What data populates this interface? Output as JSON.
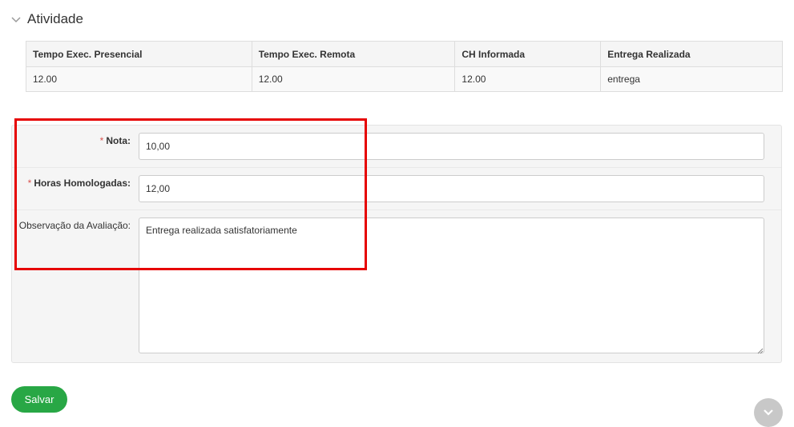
{
  "section": {
    "title": "Atividade",
    "icon": "chevron-down-icon"
  },
  "table": {
    "headers": [
      "Tempo Exec. Presencial",
      "Tempo Exec. Remota",
      "CH Informada",
      "Entrega Realizada"
    ],
    "rows": [
      [
        "12.00",
        "12.00",
        "12.00",
        "entrega"
      ]
    ]
  },
  "form": {
    "required_marker": "*",
    "nota": {
      "label": "Nota:",
      "value": "10,00"
    },
    "horas": {
      "label": "Horas Homologadas:",
      "value": "12,00"
    },
    "observacao": {
      "label": "Observação da Avaliação:",
      "value": "Entrega realizada satisfatoriamente"
    }
  },
  "actions": {
    "save_label": "Salvar",
    "scroll_icon": "chevron-down-icon"
  },
  "colors": {
    "highlight": "#e60000",
    "save_button": "#28a745",
    "required": "#d9534f"
  }
}
